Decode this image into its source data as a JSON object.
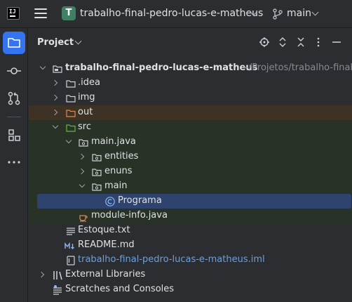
{
  "topbar": {
    "logo_text": "IJ",
    "project_badge": "T",
    "project_name": "trabalho-final-pedro-lucas-e-matheus",
    "branch": "main"
  },
  "panel": {
    "title": "Project",
    "header_icons": [
      "locate-icon",
      "expand-collapse-icon",
      "collapse-all-icon",
      "more-icon",
      "minimize-icon"
    ]
  },
  "tree": {
    "root": {
      "label": "trabalho-final-pedro-lucas-e-matheus",
      "path": "~/Projetos/trabalho-final-"
    },
    "idea": "idea",
    "img": "img",
    "out": "out",
    "src": "src",
    "main_java": "main.java",
    "entities": "entities",
    "enuns": "enuns",
    "main": "main",
    "programa": "Programa",
    "module_info": "module-info.java",
    "estoque": "Estoque.txt",
    "readme": "README.md",
    "iml": "trabalho-final-pedro-lucas-e-matheus.iml",
    "external_libraries": "External Libraries",
    "scratches": "Scratches and Consoles"
  },
  "colors": {
    "accent": "#3574f0",
    "project_badge": "#3f7f63",
    "selection": "#2e436e",
    "excluded_bg": "#3d3223",
    "source_bg": "#283227"
  }
}
